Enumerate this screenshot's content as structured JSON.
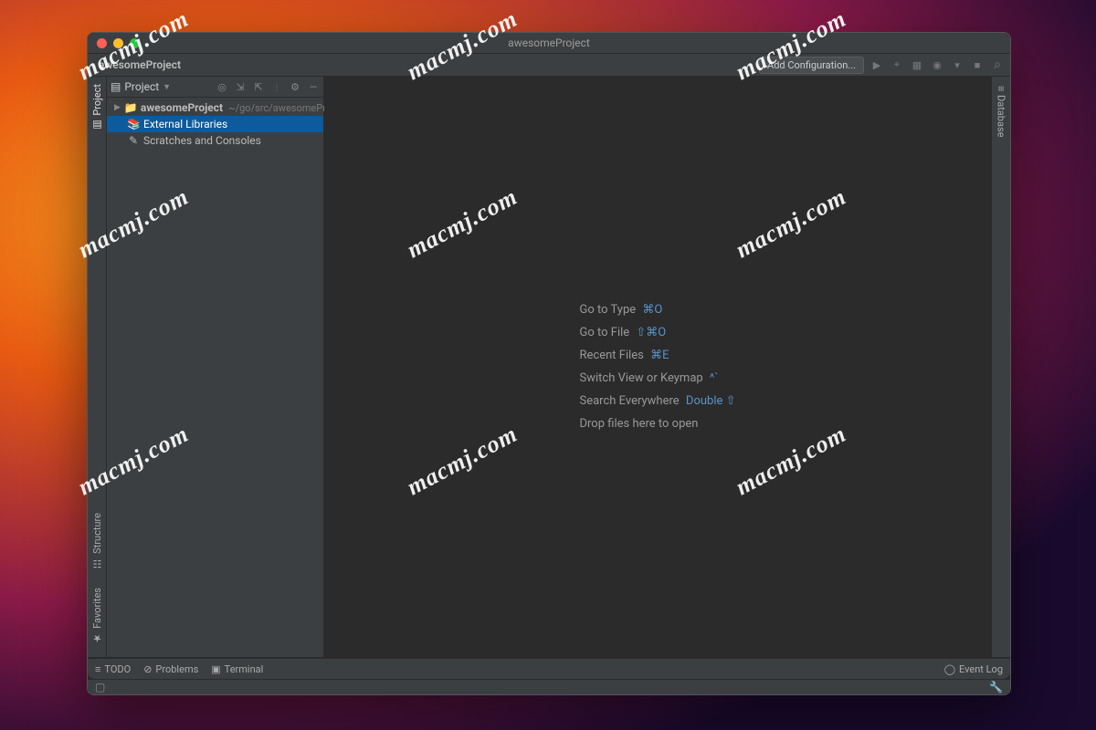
{
  "window": {
    "title": "awesomeProject"
  },
  "breadcrumb": "awesomeProject",
  "toolbar": {
    "add_config": "Add Configuration...",
    "icons": [
      "run-icon",
      "debug-icon",
      "coverage-icon",
      "profile-icon",
      "attach-icon",
      "stop-icon",
      "search-icon"
    ]
  },
  "left_tabs": {
    "top": "Project",
    "bottom": [
      "Structure",
      "Favorites"
    ]
  },
  "right_tabs": {
    "top": "Database"
  },
  "project_panel": {
    "header": "Project",
    "header_icons": [
      "target-icon",
      "expand-icon",
      "collapse-icon",
      "divider",
      "gear-icon",
      "hide-icon"
    ],
    "tree": [
      {
        "kind": "root",
        "label": "awesomeProject",
        "path": "~/go/src/awesomeProject",
        "icon": "📁"
      },
      {
        "kind": "item",
        "label": "External Libraries",
        "icon": "📚",
        "selected": true
      },
      {
        "kind": "item",
        "label": "Scratches and Consoles",
        "icon": "✎",
        "selected": false
      }
    ]
  },
  "editor_hints": [
    {
      "label": "Go to Type",
      "kbd": "⌘O"
    },
    {
      "label": "Go to File",
      "kbd": "⇧⌘O"
    },
    {
      "label": "Recent Files",
      "kbd": "⌘E"
    },
    {
      "label": "Switch View or Keymap",
      "kbd": "^`"
    },
    {
      "label": "Search Everywhere",
      "kbd": "Double ⇧"
    },
    {
      "label": "Drop files here to open",
      "kbd": ""
    }
  ],
  "bottom_bar": {
    "items": [
      {
        "icon": "≡",
        "label": "TODO"
      },
      {
        "icon": "⊘",
        "label": "Problems"
      },
      {
        "icon": "▣",
        "label": "Terminal"
      }
    ],
    "right": {
      "icon": "◯",
      "label": "Event Log"
    }
  },
  "watermark_text": "macmj.com"
}
